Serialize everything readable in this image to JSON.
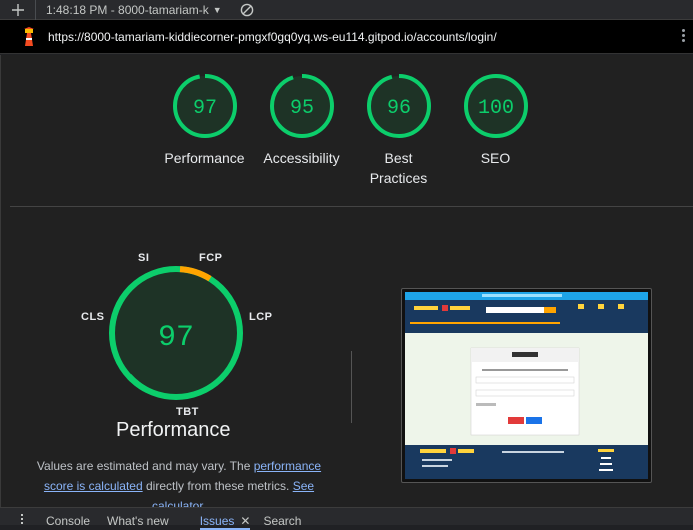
{
  "toolbar": {
    "report_picker": "1:48:18 PM - 8000-tamariam-k"
  },
  "urlbar": {
    "url": "https://8000-tamariam-kiddiecorner-pmgxf0gq0yq.ws-eu114.gitpod.io/accounts/login/"
  },
  "scores": [
    {
      "value": "97",
      "label": "Performance",
      "fraction": 0.97
    },
    {
      "value": "95",
      "label": "Accessibility",
      "fraction": 0.95
    },
    {
      "value": "96",
      "label": "Best\nPractices",
      "fraction": 0.96
    },
    {
      "value": "100",
      "label": "SEO",
      "fraction": 1.0
    }
  ],
  "performance": {
    "score": "97",
    "title": "Performance",
    "metrics": {
      "si": "SI",
      "fcp": "FCP",
      "lcp": "LCP",
      "tbt": "TBT",
      "cls": "CLS"
    },
    "note_prefix": "Values are estimated and may vary. The ",
    "note_link1": "performance score is calculated",
    "note_middle": " directly from these metrics. ",
    "note_link2": "See calculator."
  },
  "bottom_tabs": [
    "Console",
    "What's new",
    "Issues",
    "Search"
  ],
  "colors": {
    "pass": "#0cce6b",
    "average": "#ffa400",
    "bg": "#212121"
  }
}
